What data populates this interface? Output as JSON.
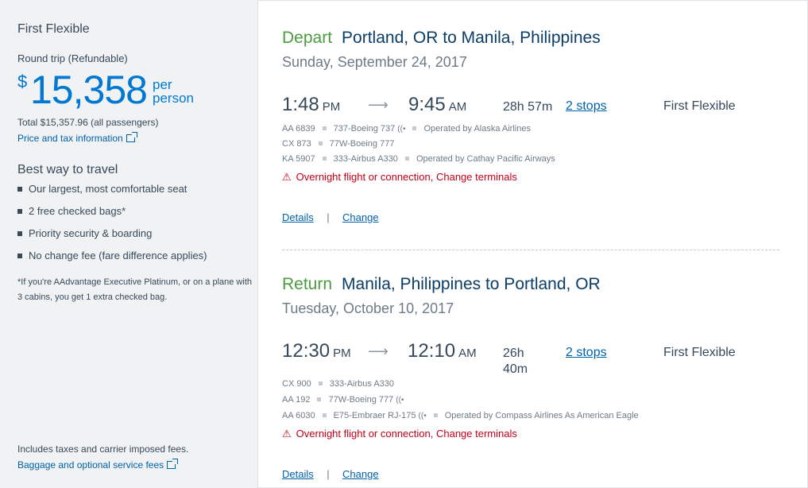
{
  "sidebar": {
    "fare_name": "First Flexible",
    "trip_type": "Round trip (Refundable)",
    "currency_symbol": "$",
    "price": "15,358",
    "per_line1": "per",
    "per_line2": "person",
    "total": "Total $15,357.96 (all passengers)",
    "price_link": "Price and tax information",
    "best_heading": "Best way to travel",
    "benefits": [
      "Our largest, most comfortable seat",
      "2 free checked bags*",
      "Priority security & boarding",
      "No change fee (fare difference applies)"
    ],
    "footnote": "*If you're AAdvantage Executive Platinum, or on a plane with 3 cabins, you get 1 extra checked bag.",
    "taxes_note": "Includes taxes and carrier imposed fees.",
    "baggage_link": "Baggage and optional service fees"
  },
  "depart": {
    "label": "Depart",
    "route": "Portland, OR to Manila, Philippines",
    "date": "Sunday, September 24, 2017",
    "dep_time": "1:48",
    "dep_ampm": "PM",
    "arr_time": "9:45",
    "arr_ampm": "AM",
    "duration": "28h 57m",
    "stops": "2 stops",
    "cabin": "First Flexible",
    "segments": [
      {
        "flight": "AA 6839",
        "aircraft": "737-Boeing 737",
        "wifi": true,
        "operator": "Operated by Alaska Airlines"
      },
      {
        "flight": "CX 873",
        "aircraft": "77W-Boeing 777",
        "wifi": false,
        "operator": ""
      },
      {
        "flight": "KA 5907",
        "aircraft": "333-Airbus A330",
        "wifi": false,
        "operator": "Operated by Cathay Pacific Airways"
      }
    ],
    "warning": "Overnight flight or connection, Change terminals",
    "details": "Details",
    "change": "Change"
  },
  "return": {
    "label": "Return",
    "route": "Manila, Philippines to Portland, OR",
    "date": "Tuesday, October 10, 2017",
    "dep_time": "12:30",
    "dep_ampm": "PM",
    "arr_time": "12:10",
    "arr_ampm": "AM",
    "duration_line1": "26h",
    "duration_line2": "40m",
    "stops": "2 stops",
    "cabin": "First Flexible",
    "segments": [
      {
        "flight": "CX 900",
        "aircraft": "333-Airbus A330",
        "wifi": false,
        "operator": ""
      },
      {
        "flight": "AA 192",
        "aircraft": "77W-Boeing 777",
        "wifi": true,
        "operator": ""
      },
      {
        "flight": "AA 6030",
        "aircraft": "E75-Embraer RJ-175",
        "wifi": true,
        "operator": "Operated by Compass Airlines As American Eagle"
      }
    ],
    "warning": "Overnight flight or connection, Change terminals",
    "details": "Details",
    "change": "Change"
  },
  "separator": "|",
  "colors": {
    "accent_blue": "#0078d2",
    "link_blue": "#0061ab",
    "direction_green": "#4b9b3f",
    "warning_red": "#c30019"
  }
}
